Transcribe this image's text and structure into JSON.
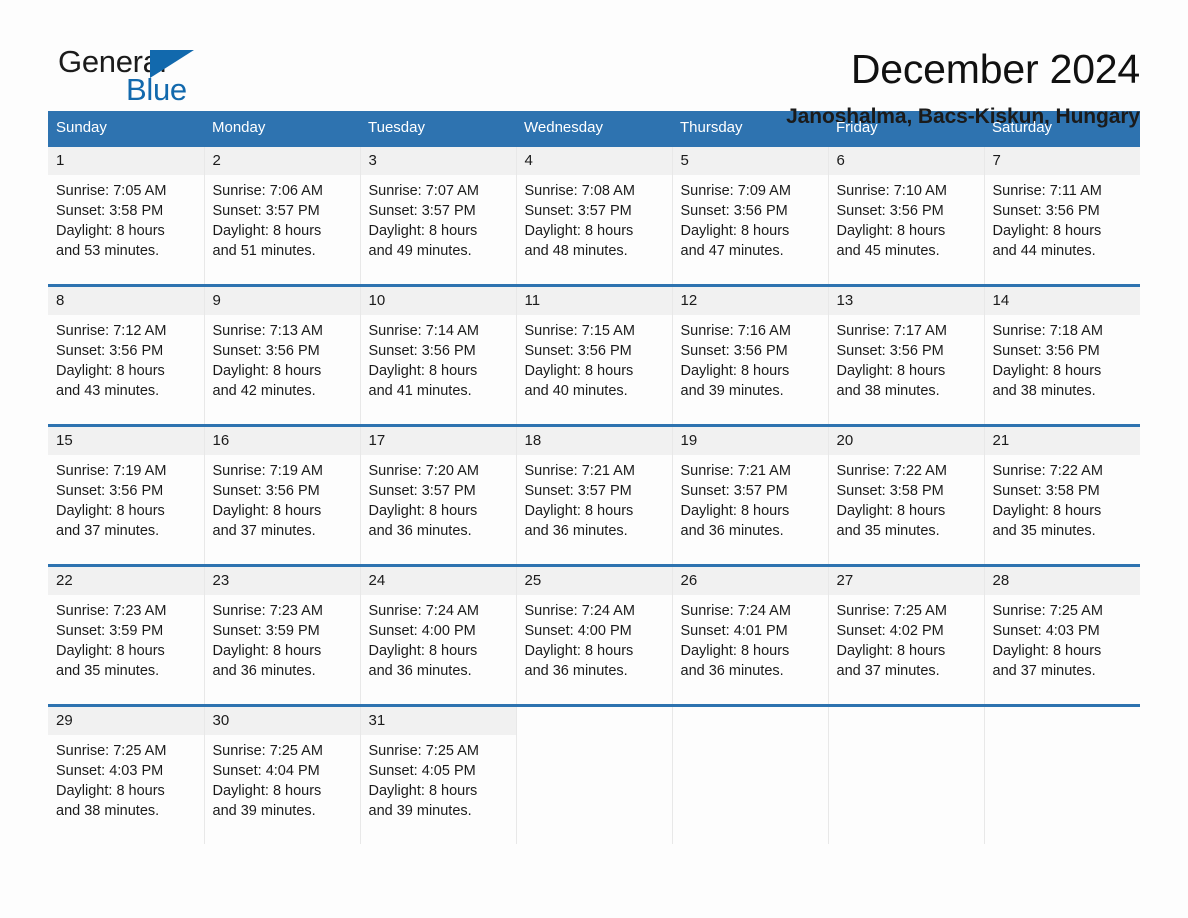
{
  "brand": {
    "name_part1": "General",
    "name_part2": "Blue",
    "triangle_color": "#1269ad",
    "text_color": "#1b1b1b"
  },
  "header": {
    "title": "December 2024",
    "location": "Janoshalma, Bacs-Kiskun, Hungary",
    "accent_color": "#2e73b0",
    "daynum_band_color": "#f1f1f1"
  },
  "calendar": {
    "weekday_headers": [
      "Sunday",
      "Monday",
      "Tuesday",
      "Wednesday",
      "Thursday",
      "Friday",
      "Saturday"
    ],
    "labels": {
      "sunrise": "Sunrise:",
      "sunset": "Sunset:",
      "daylight": "Daylight:"
    },
    "weeks": [
      [
        {
          "day": "1",
          "sunrise": "Sunrise: 7:05 AM",
          "sunset": "Sunset: 3:58 PM",
          "daylight_line1": "Daylight: 8 hours",
          "daylight_line2": "and 53 minutes."
        },
        {
          "day": "2",
          "sunrise": "Sunrise: 7:06 AM",
          "sunset": "Sunset: 3:57 PM",
          "daylight_line1": "Daylight: 8 hours",
          "daylight_line2": "and 51 minutes."
        },
        {
          "day": "3",
          "sunrise": "Sunrise: 7:07 AM",
          "sunset": "Sunset: 3:57 PM",
          "daylight_line1": "Daylight: 8 hours",
          "daylight_line2": "and 49 minutes."
        },
        {
          "day": "4",
          "sunrise": "Sunrise: 7:08 AM",
          "sunset": "Sunset: 3:57 PM",
          "daylight_line1": "Daylight: 8 hours",
          "daylight_line2": "and 48 minutes."
        },
        {
          "day": "5",
          "sunrise": "Sunrise: 7:09 AM",
          "sunset": "Sunset: 3:56 PM",
          "daylight_line1": "Daylight: 8 hours",
          "daylight_line2": "and 47 minutes."
        },
        {
          "day": "6",
          "sunrise": "Sunrise: 7:10 AM",
          "sunset": "Sunset: 3:56 PM",
          "daylight_line1": "Daylight: 8 hours",
          "daylight_line2": "and 45 minutes."
        },
        {
          "day": "7",
          "sunrise": "Sunrise: 7:11 AM",
          "sunset": "Sunset: 3:56 PM",
          "daylight_line1": "Daylight: 8 hours",
          "daylight_line2": "and 44 minutes."
        }
      ],
      [
        {
          "day": "8",
          "sunrise": "Sunrise: 7:12 AM",
          "sunset": "Sunset: 3:56 PM",
          "daylight_line1": "Daylight: 8 hours",
          "daylight_line2": "and 43 minutes."
        },
        {
          "day": "9",
          "sunrise": "Sunrise: 7:13 AM",
          "sunset": "Sunset: 3:56 PM",
          "daylight_line1": "Daylight: 8 hours",
          "daylight_line2": "and 42 minutes."
        },
        {
          "day": "10",
          "sunrise": "Sunrise: 7:14 AM",
          "sunset": "Sunset: 3:56 PM",
          "daylight_line1": "Daylight: 8 hours",
          "daylight_line2": "and 41 minutes."
        },
        {
          "day": "11",
          "sunrise": "Sunrise: 7:15 AM",
          "sunset": "Sunset: 3:56 PM",
          "daylight_line1": "Daylight: 8 hours",
          "daylight_line2": "and 40 minutes."
        },
        {
          "day": "12",
          "sunrise": "Sunrise: 7:16 AM",
          "sunset": "Sunset: 3:56 PM",
          "daylight_line1": "Daylight: 8 hours",
          "daylight_line2": "and 39 minutes."
        },
        {
          "day": "13",
          "sunrise": "Sunrise: 7:17 AM",
          "sunset": "Sunset: 3:56 PM",
          "daylight_line1": "Daylight: 8 hours",
          "daylight_line2": "and 38 minutes."
        },
        {
          "day": "14",
          "sunrise": "Sunrise: 7:18 AM",
          "sunset": "Sunset: 3:56 PM",
          "daylight_line1": "Daylight: 8 hours",
          "daylight_line2": "and 38 minutes."
        }
      ],
      [
        {
          "day": "15",
          "sunrise": "Sunrise: 7:19 AM",
          "sunset": "Sunset: 3:56 PM",
          "daylight_line1": "Daylight: 8 hours",
          "daylight_line2": "and 37 minutes."
        },
        {
          "day": "16",
          "sunrise": "Sunrise: 7:19 AM",
          "sunset": "Sunset: 3:56 PM",
          "daylight_line1": "Daylight: 8 hours",
          "daylight_line2": "and 37 minutes."
        },
        {
          "day": "17",
          "sunrise": "Sunrise: 7:20 AM",
          "sunset": "Sunset: 3:57 PM",
          "daylight_line1": "Daylight: 8 hours",
          "daylight_line2": "and 36 minutes."
        },
        {
          "day": "18",
          "sunrise": "Sunrise: 7:21 AM",
          "sunset": "Sunset: 3:57 PM",
          "daylight_line1": "Daylight: 8 hours",
          "daylight_line2": "and 36 minutes."
        },
        {
          "day": "19",
          "sunrise": "Sunrise: 7:21 AM",
          "sunset": "Sunset: 3:57 PM",
          "daylight_line1": "Daylight: 8 hours",
          "daylight_line2": "and 36 minutes."
        },
        {
          "day": "20",
          "sunrise": "Sunrise: 7:22 AM",
          "sunset": "Sunset: 3:58 PM",
          "daylight_line1": "Daylight: 8 hours",
          "daylight_line2": "and 35 minutes."
        },
        {
          "day": "21",
          "sunrise": "Sunrise: 7:22 AM",
          "sunset": "Sunset: 3:58 PM",
          "daylight_line1": "Daylight: 8 hours",
          "daylight_line2": "and 35 minutes."
        }
      ],
      [
        {
          "day": "22",
          "sunrise": "Sunrise: 7:23 AM",
          "sunset": "Sunset: 3:59 PM",
          "daylight_line1": "Daylight: 8 hours",
          "daylight_line2": "and 35 minutes."
        },
        {
          "day": "23",
          "sunrise": "Sunrise: 7:23 AM",
          "sunset": "Sunset: 3:59 PM",
          "daylight_line1": "Daylight: 8 hours",
          "daylight_line2": "and 36 minutes."
        },
        {
          "day": "24",
          "sunrise": "Sunrise: 7:24 AM",
          "sunset": "Sunset: 4:00 PM",
          "daylight_line1": "Daylight: 8 hours",
          "daylight_line2": "and 36 minutes."
        },
        {
          "day": "25",
          "sunrise": "Sunrise: 7:24 AM",
          "sunset": "Sunset: 4:00 PM",
          "daylight_line1": "Daylight: 8 hours",
          "daylight_line2": "and 36 minutes."
        },
        {
          "day": "26",
          "sunrise": "Sunrise: 7:24 AM",
          "sunset": "Sunset: 4:01 PM",
          "daylight_line1": "Daylight: 8 hours",
          "daylight_line2": "and 36 minutes."
        },
        {
          "day": "27",
          "sunrise": "Sunrise: 7:25 AM",
          "sunset": "Sunset: 4:02 PM",
          "daylight_line1": "Daylight: 8 hours",
          "daylight_line2": "and 37 minutes."
        },
        {
          "day": "28",
          "sunrise": "Sunrise: 7:25 AM",
          "sunset": "Sunset: 4:03 PM",
          "daylight_line1": "Daylight: 8 hours",
          "daylight_line2": "and 37 minutes."
        }
      ],
      [
        {
          "day": "29",
          "sunrise": "Sunrise: 7:25 AM",
          "sunset": "Sunset: 4:03 PM",
          "daylight_line1": "Daylight: 8 hours",
          "daylight_line2": "and 38 minutes."
        },
        {
          "day": "30",
          "sunrise": "Sunrise: 7:25 AM",
          "sunset": "Sunset: 4:04 PM",
          "daylight_line1": "Daylight: 8 hours",
          "daylight_line2": "and 39 minutes."
        },
        {
          "day": "31",
          "sunrise": "Sunrise: 7:25 AM",
          "sunset": "Sunset: 4:05 PM",
          "daylight_line1": "Daylight: 8 hours",
          "daylight_line2": "and 39 minutes."
        },
        {
          "day": "",
          "sunrise": "",
          "sunset": "",
          "daylight_line1": "",
          "daylight_line2": ""
        },
        {
          "day": "",
          "sunrise": "",
          "sunset": "",
          "daylight_line1": "",
          "daylight_line2": ""
        },
        {
          "day": "",
          "sunrise": "",
          "sunset": "",
          "daylight_line1": "",
          "daylight_line2": ""
        },
        {
          "day": "",
          "sunrise": "",
          "sunset": "",
          "daylight_line1": "",
          "daylight_line2": ""
        }
      ]
    ]
  }
}
